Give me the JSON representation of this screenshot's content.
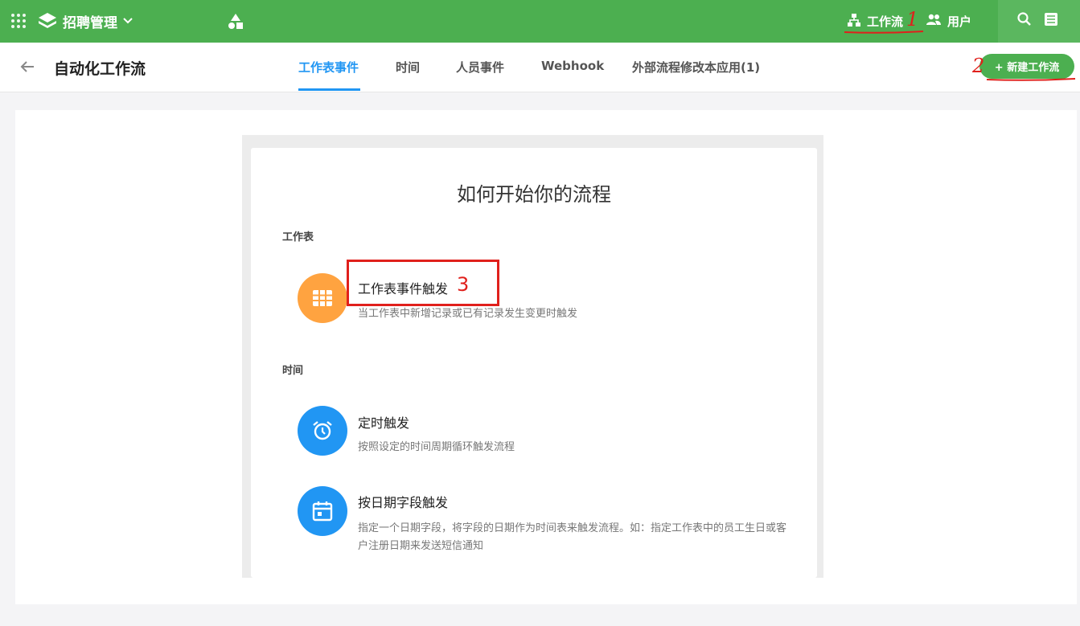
{
  "topbar": {
    "app_name": "招聘管理",
    "workflow_label": "工作流",
    "users_label": "用户",
    "annotation_1": "1",
    "annotation_2": "2",
    "annotation_3": "3"
  },
  "header": {
    "title": "自动化工作流",
    "tabs": [
      {
        "label": "工作表事件"
      },
      {
        "label": "时间"
      },
      {
        "label": "人员事件"
      },
      {
        "label": "Webhook"
      },
      {
        "label": "外部流程修改本应用(1)"
      }
    ],
    "new_button": "+ 新建工作流"
  },
  "main": {
    "heading": "如何开始你的流程",
    "sections": [
      {
        "label": "工作表",
        "items": [
          {
            "title": "工作表事件触发",
            "desc": "当工作表中新增记录或已有记录发生变更时触发",
            "icon": "table-grid-icon",
            "color": "#ffa340"
          }
        ]
      },
      {
        "label": "时间",
        "items": [
          {
            "title": "定时触发",
            "desc": "按照设定的时间周期循环触发流程",
            "icon": "alarm-clock-icon",
            "color": "#2196f3"
          },
          {
            "title": "按日期字段触发",
            "desc": "指定一个日期字段，将字段的日期作为时间表来触发流程。如：指定工作表中的员工生日或客户注册日期来发送短信通知",
            "icon": "calendar-icon",
            "color": "#2196f3"
          }
        ]
      }
    ]
  }
}
